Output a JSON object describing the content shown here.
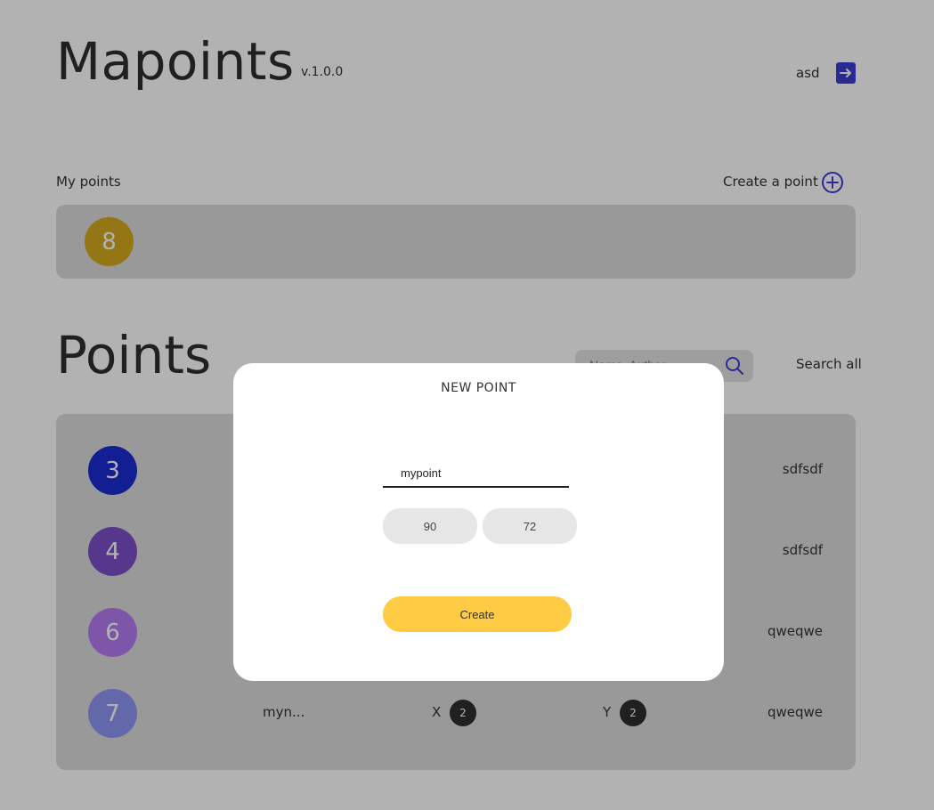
{
  "header": {
    "app_title": "Mapoints",
    "version": "v.1.0.0",
    "username": "asd",
    "logout_icon": "arrow-right-icon"
  },
  "my_points": {
    "label": "My points",
    "create_label": "Create a point",
    "items": [
      {
        "number": "8",
        "color": "#d4a91f"
      }
    ]
  },
  "points": {
    "title": "Points",
    "search_placeholder": "Name, Author",
    "search_all_label": "Search all",
    "rows": [
      {
        "number": "3",
        "color": "#1b2bd0",
        "name": "",
        "x_label": "",
        "x": "",
        "y_label": "",
        "y": "",
        "author": "sdfsdf"
      },
      {
        "number": "4",
        "color": "#7b4fc7",
        "name": "",
        "x_label": "",
        "x": "",
        "y_label": "",
        "y": "",
        "author": "sdfsdf"
      },
      {
        "number": "6",
        "color": "#b47bf2",
        "name": "",
        "x_label": "",
        "x": "",
        "y_label": "",
        "y": "",
        "author": "qweqwe"
      },
      {
        "number": "7",
        "color": "#8f95f5",
        "name": "myn...",
        "x_label": "X",
        "x": "2",
        "y_label": "Y",
        "y": "2",
        "author": "qweqwe"
      }
    ]
  },
  "modal": {
    "title": "NEW POINT",
    "name_value": "mypoint",
    "x_value": "90",
    "y_value": "72",
    "create_label": "Create"
  }
}
